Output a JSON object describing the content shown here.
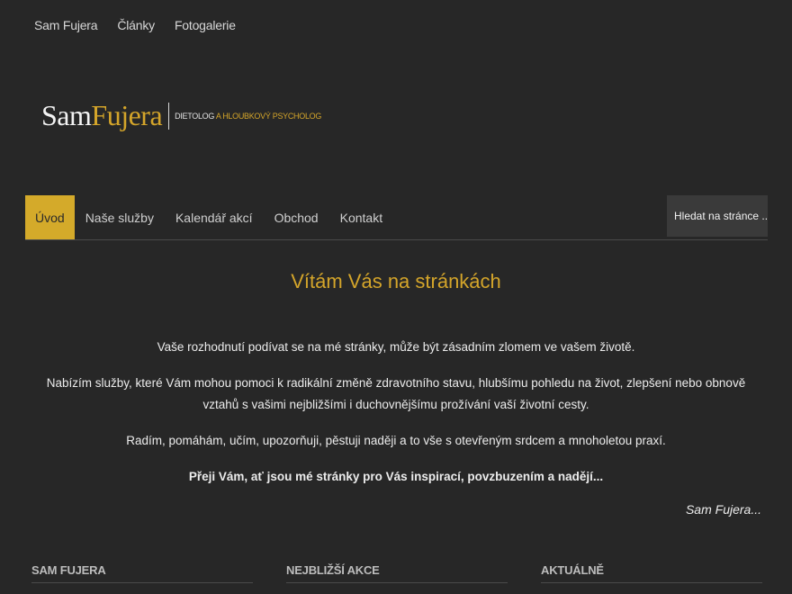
{
  "topnav": {
    "items": [
      "Sam Fujera",
      "Články",
      "Fotogalerie"
    ]
  },
  "logo": {
    "first": "Sam",
    "second": "Fujera",
    "tagline_part1": "DIETOLOG",
    "tagline_part2": "A HLOUBKOVÝ PSYCHOLOG"
  },
  "mainnav": {
    "items": [
      "Úvod",
      "Naše služby",
      "Kalendář akcí",
      "Obchod",
      "Kontakt"
    ],
    "active_index": 0,
    "search_placeholder": "Hledat na stránce ..."
  },
  "main": {
    "title": "Vítám Vás na stránkách",
    "paragraphs": [
      "Vaše rozhodnutí podívat se na mé stránky, může být zásadním zlomem ve vašem životě.",
      "Nabízím služby, které Vám mohou pomoci k radikální změně zdravotního stavu, hlubšímu pohledu na život, zlepšení nebo obnově vztahů s vašimi nejbližšími i duchovnějšímu prožívání vaší životní cesty.",
      "Radím, pomáhám, učím, upozorňuji, pěstuji naději a to vše s otevřeným srdcem a mnoholetou praxí.",
      "Přeji Vám, ať jsou mé stránky pro Vás inspirací, povzbuzením a nadějí..."
    ],
    "signature": "Sam Fujera..."
  },
  "footer": {
    "columns": [
      "SAM FUJERA",
      "NEJBLIŽŠÍ AKCE",
      "AKTUÁLNĚ"
    ]
  },
  "colors": {
    "background": "#272727",
    "accent": "#d4aa2a"
  }
}
